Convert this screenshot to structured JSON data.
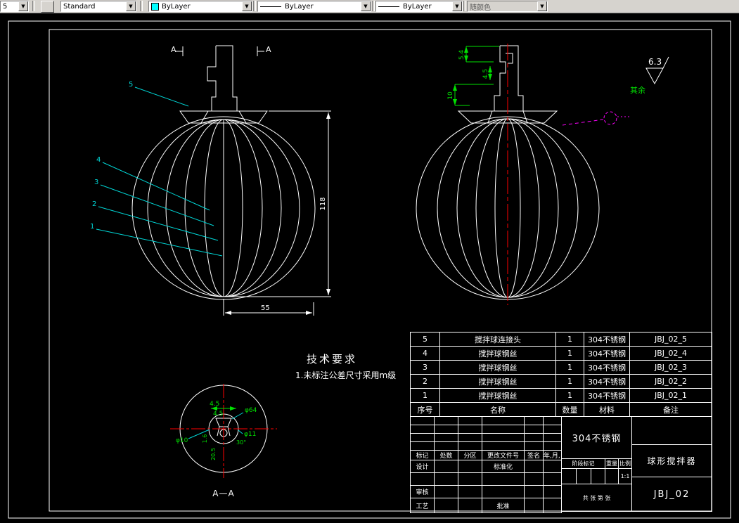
{
  "toolbar": {
    "layer_value": "5",
    "style_value": "Standard",
    "color_value": "ByLayer",
    "linetype_value": "ByLayer",
    "lineweight_value": "ByLayer",
    "plotstyle_value": "随颜色"
  },
  "front_view": {
    "section_mark_left": "A",
    "section_mark_right": "A",
    "balloon_5": "5",
    "balloon_4": "4",
    "balloon_3": "3",
    "balloon_2": "2",
    "balloon_1": "1",
    "dim_width": "55",
    "dim_height": "118"
  },
  "side_view": {
    "dim_top": "5.4",
    "dim_mid": "4.5",
    "dim_low": "10",
    "roughness_value": "6.3",
    "roughness_note": "其余"
  },
  "section_view": {
    "label": "A—A",
    "dim_a": "4.5",
    "dim_b": "4.5",
    "dim_c": "φ64",
    "dim_d": "φ11",
    "dim_e": "φ10",
    "dim_f": "1.6",
    "dim_g": "20.5",
    "dim_h": "30°"
  },
  "tech_req": {
    "title": "技术要求",
    "item1": "1.未标注公差尺寸采用m级"
  },
  "bom": {
    "headers": {
      "no": "序号",
      "name": "名称",
      "qty": "数量",
      "material": "材料",
      "remark": "备注"
    },
    "rows": [
      {
        "no": "5",
        "name": "搅拌球连接头",
        "qty": "1",
        "material": "304不锈钢",
        "remark": "JBJ_02_5"
      },
      {
        "no": "4",
        "name": "搅拌球钢丝",
        "qty": "1",
        "material": "304不锈钢",
        "remark": "JBJ_02_4"
      },
      {
        "no": "3",
        "name": "搅拌球钢丝",
        "qty": "1",
        "material": "304不锈钢",
        "remark": "JBJ_02_3"
      },
      {
        "no": "2",
        "name": "搅拌球钢丝",
        "qty": "1",
        "material": "304不锈钢",
        "remark": "JBJ_02_2"
      },
      {
        "no": "1",
        "name": "搅拌球钢丝",
        "qty": "1",
        "material": "304不锈钢",
        "remark": "JBJ_02_1"
      }
    ]
  },
  "title_block": {
    "material": "304不锈钢",
    "product_name": "球形搅拌器",
    "drawing_number": "JBJ_02",
    "scale_value": "1:1",
    "sheet_note": "共 张 第 张",
    "labels": {
      "mark": "标记",
      "count": "处数",
      "zone": "分区",
      "doc": "更改文件号",
      "sign": "签名",
      "date": "年,月,日",
      "design": "设计",
      "standard": "标准化",
      "check": "审核",
      "process": "工艺",
      "approve": "批准",
      "stage": "阶段标记",
      "weight": "重量",
      "scale": "比例"
    }
  },
  "colors": {
    "line": "#ffffff",
    "dimension": "#00e000",
    "leader": "#00d7d7",
    "centerline": "#ff0000",
    "highlight": "#ff00ff",
    "toolbar_bg": "#d6d3ce"
  }
}
